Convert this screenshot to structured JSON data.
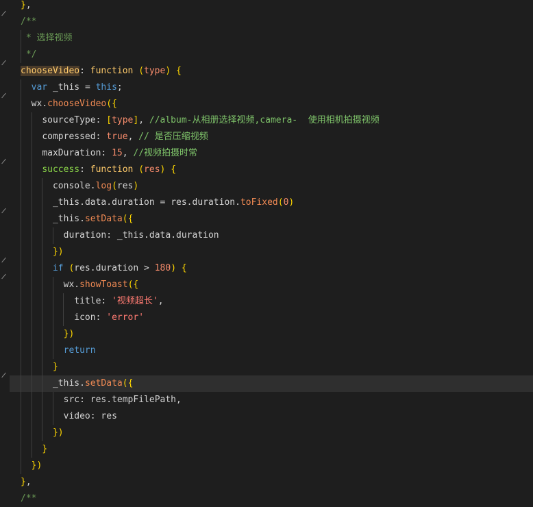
{
  "code": {
    "lines": [
      "},",
      "/**",
      " * 选择视频",
      " */",
      "chooseVideo: function (type) {",
      "  var _this = this;",
      "  wx.chooseVideo({",
      "    sourceType: [type], //album-从相册选择视频,camera-  使用相机拍摄视频",
      "    compressed: true, // 是否压缩视频",
      "    maxDuration: 15, //视频拍摄时常",
      "    success: function (res) {",
      "      console.log(res)",
      "      _this.data.duration = res.duration.toFixed(0)",
      "      _this.setData({",
      "        duration: _this.data.duration",
      "      })",
      "      if (res.duration > 180) {",
      "        wx.showToast({",
      "          title: '视频超长',",
      "          icon: 'error'",
      "        })",
      "        return",
      "      }",
      "      _this.setData({",
      "        src: res.tempFilePath,",
      "        video: res",
      "      })",
      "    }",
      "  })",
      "},",
      "/**"
    ]
  },
  "colors": {
    "background": "#1e1e1e",
    "active_line": "#2f2f2f",
    "comment": "#6a9955",
    "keyword_fn": "#ffcb6b",
    "method": "#f28b54",
    "number": "#f78c6c",
    "string": "#ce9178"
  }
}
